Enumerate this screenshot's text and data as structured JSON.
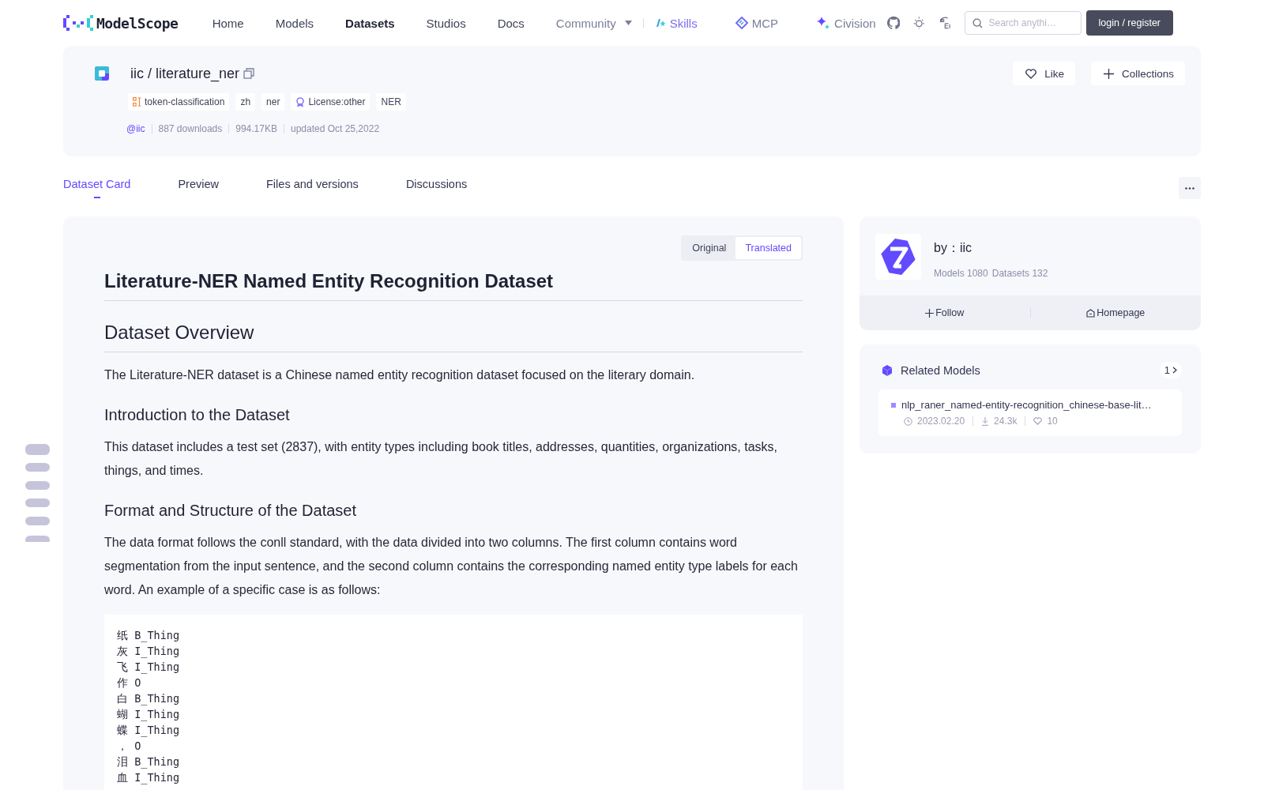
{
  "nav": {
    "brand": "ModelScope",
    "items": [
      {
        "label": "Home",
        "selected": false,
        "kind": "plain"
      },
      {
        "label": "Models",
        "selected": false,
        "kind": "plain"
      },
      {
        "label": "Datasets",
        "selected": true,
        "kind": "plain"
      },
      {
        "label": "Studios",
        "selected": false,
        "kind": "plain"
      },
      {
        "label": "Docs",
        "selected": false,
        "kind": "plain"
      },
      {
        "label": "Community",
        "selected": false,
        "kind": "dropdown"
      },
      {
        "label": "Skills",
        "selected": false,
        "kind": "skills"
      },
      {
        "label": "MCP",
        "selected": false,
        "kind": "mcp"
      },
      {
        "label": "Civision",
        "selected": false,
        "kind": "civision"
      }
    ],
    "search": {
      "placeholder": "Search anythi…"
    },
    "login": "login / register"
  },
  "repo": {
    "owner": "iic",
    "separator": "/",
    "name": "literature_ner",
    "tags": [
      {
        "label": "token-classification",
        "kind": "task"
      },
      {
        "label": "zh",
        "kind": "plain"
      },
      {
        "label": "ner",
        "kind": "plain"
      },
      {
        "label": "License:other",
        "kind": "license"
      },
      {
        "label": "NER",
        "kind": "plain"
      }
    ],
    "author": "@iic",
    "meta": [
      "887 downloads",
      "994.17KB",
      "updated Oct 25,2022"
    ],
    "actions": [
      {
        "label": "Like",
        "kind": "like"
      },
      {
        "label": "Collections",
        "kind": "add"
      }
    ]
  },
  "tabs": [
    {
      "label": "Dataset Card",
      "selected": true
    },
    {
      "label": "Preview",
      "selected": false
    },
    {
      "label": "Files and versions",
      "selected": false
    },
    {
      "label": "Discussions",
      "selected": false
    }
  ],
  "language_toggle": [
    {
      "label": "Original",
      "selected": false
    },
    {
      "label": "Translated",
      "selected": true
    }
  ],
  "article": {
    "title": "Literature-NER Named Entity Recognition Dataset",
    "blocks": [
      {
        "kind": "h2",
        "text": "Dataset Overview"
      },
      {
        "kind": "p",
        "text": "The Literature-NER dataset is a Chinese named entity recognition dataset focused on the literary domain."
      },
      {
        "kind": "h3",
        "text": "Introduction to the Dataset"
      },
      {
        "kind": "p",
        "text": "This dataset includes a test set (2837), with entity types including book titles, addresses, quantities, organizations, tasks, things, and times."
      },
      {
        "kind": "h3",
        "text": "Format and Structure of the Dataset"
      },
      {
        "kind": "p",
        "text": "The data format follows the conll standard, with the data divided into two columns. The first column contains word segmentation from the input sentence, and the second column contains the corresponding named entity type labels for each word. An example of a specific case is as follows:"
      },
      {
        "kind": "code",
        "lines": [
          "纸 B_Thing",
          "灰 I_Thing",
          "飞 I_Thing",
          "作 O",
          "白 B_Thing",
          "蝴 I_Thing",
          "蝶 I_Thing",
          "， O",
          "泪 B_Thing",
          "血 I_Thing"
        ]
      }
    ]
  },
  "owner_card": {
    "name": "by：iic",
    "stats": [
      "Models 1080",
      "Datasets 132"
    ],
    "buttons": [
      {
        "label": "Follow",
        "kind": "follow"
      },
      {
        "label": "Homepage",
        "kind": "home"
      }
    ]
  },
  "related_models": {
    "title": "Related Models",
    "count": "1",
    "items": [
      {
        "name": "nlp_raner_named-entity-recognition_chinese-base-lit…",
        "date": "2023.02.20",
        "downloads": "24.3k",
        "likes": "10"
      }
    ]
  }
}
